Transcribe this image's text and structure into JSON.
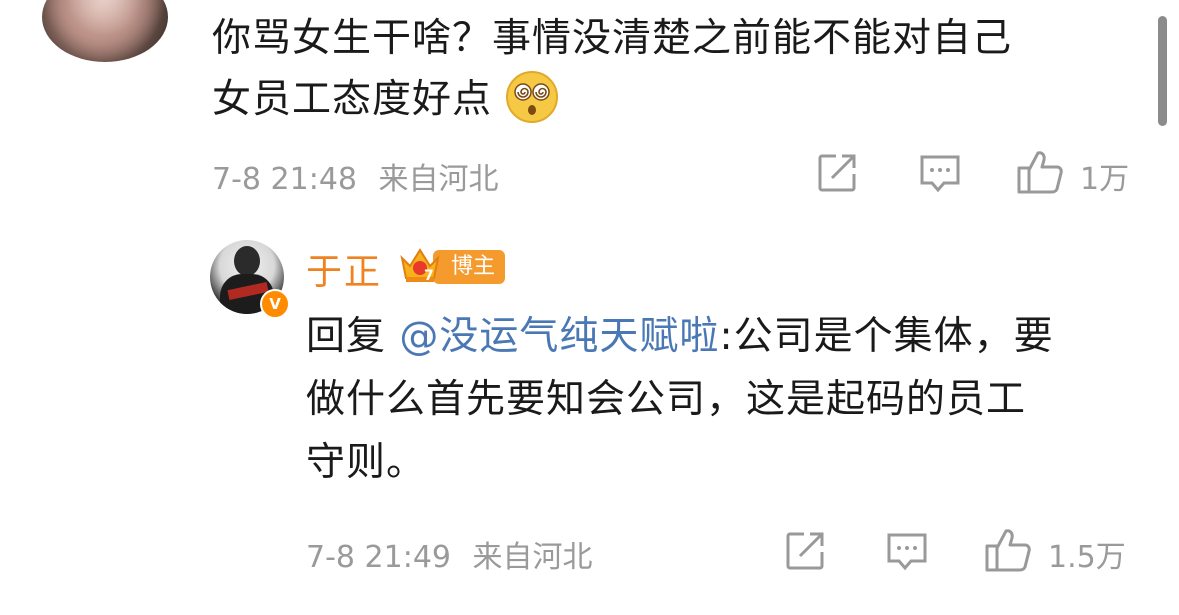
{
  "comment": {
    "text_line1": "你骂女生干啥？事情没清楚之前能不能对自己",
    "text_line2": "女员工态度好点",
    "emoji": "dizzy-face-emoji",
    "timestamp": "7-8 21:48",
    "location": "来自河北",
    "like_count": "1万"
  },
  "reply": {
    "username": "于正",
    "level": "7",
    "badge": "博主",
    "verified_badge": "V",
    "reply_prefix": "回复",
    "mention": "@没运气纯天赋啦",
    "text_first": ":公司是个集体，要",
    "text_line2": "做什么首先要知会公司，这是起码的员工",
    "text_line3": "守则。",
    "timestamp": "7-8 21:49",
    "location": "来自河北",
    "like_count": "1.5万"
  },
  "icons": [
    "share-icon",
    "comment-icon",
    "like-icon"
  ],
  "colors": {
    "username": "#f08321",
    "mention": "#4a78b5",
    "meta": "#9a9a9a",
    "badge": "#f59a2c"
  }
}
